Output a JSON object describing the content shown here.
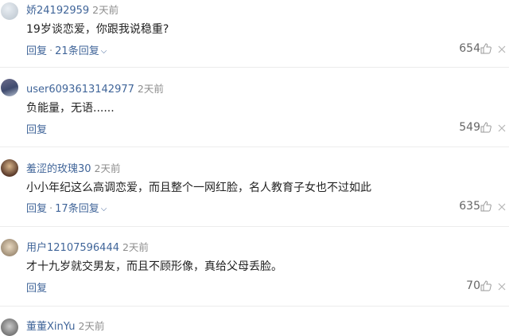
{
  "comments": [
    {
      "username": "娇24192959",
      "time": "2天前",
      "text": "19岁谈恋爱，你跟我说稳重?",
      "reply_label": "回复",
      "replies_label": "21条回复",
      "likes": "654"
    },
    {
      "username": "user6093613142977",
      "time": "2天前",
      "text": "负能量，无语......",
      "reply_label": "回复",
      "replies_label": "",
      "likes": "549"
    },
    {
      "username": "羞涩的玫瑰30",
      "time": "2天前",
      "text": "小小年纪这么高调恋爱，而且整个一网红脸，名人教育子女也不过如此",
      "reply_label": "回复",
      "replies_label": "17条回复",
      "likes": "635"
    },
    {
      "username": "用户12107596444",
      "time": "2天前",
      "text": "才十九岁就交男友，而且不顾形像，真给父母丢脸。",
      "reply_label": "回复",
      "replies_label": "",
      "likes": "70"
    },
    {
      "username": "董董XinYu",
      "time": "2天前"
    }
  ],
  "icons": {
    "like": "thumbs-up-icon",
    "more": "cross-icon",
    "expand": "chevron-down-icon"
  },
  "colors": {
    "username": "#406599",
    "link": "#406599",
    "muted": "#8d8d8d"
  }
}
